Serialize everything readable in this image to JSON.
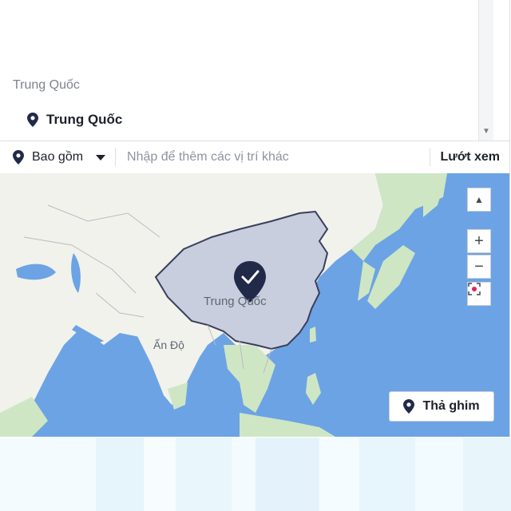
{
  "location_list": {
    "region_label": "Trung Quốc",
    "selected_location": "Trung Quốc"
  },
  "toolbar": {
    "include_label": "Bao gồm",
    "location_input_placeholder": "Nhập để thêm các vị trí khác",
    "browse_label": "Lướt xem"
  },
  "map": {
    "selected_region_label": "Trung Quốc",
    "city_label": "Ấn Độ",
    "zoom_in_label": "+",
    "zoom_out_label": "−",
    "drop_pin_label": "Thả ghim",
    "colors": {
      "ocean": "#6ca3e4",
      "land": "#f1f2ec",
      "vegetation": "#bfe0b4",
      "selected_region": "#c8cede",
      "selected_border": "#3a3f5c",
      "pin": "#222a4a"
    }
  },
  "icons": {
    "pin": "map-pin-icon",
    "check_pin": "check-pin-icon",
    "recenter": "recenter-icon",
    "collapse": "chevron-up-icon",
    "scroll_down": "triangle-down-icon"
  }
}
